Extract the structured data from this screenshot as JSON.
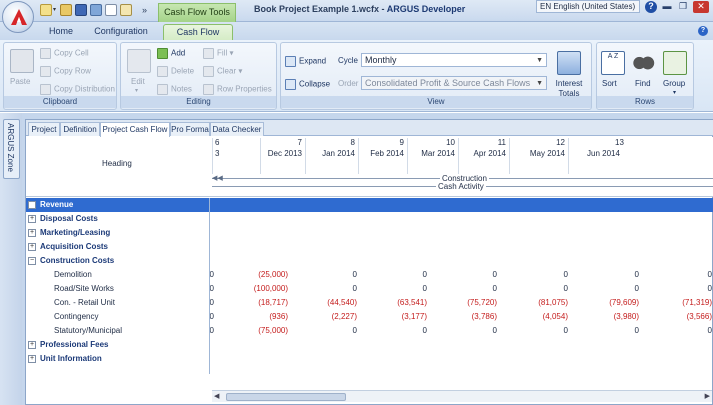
{
  "titlebar": {
    "context_tab": "Cash Flow Tools",
    "doc_title_prefix": "Book Project Example 1.wcfx - ",
    "doc_title_app": "ARGUS Developer",
    "language": "EN English (United States)",
    "qat_overflow": "»"
  },
  "ribbon_tabs": [
    "Home",
    "Configuration",
    "Cash Flow"
  ],
  "ribbon": {
    "clipboard": {
      "label": "Clipboard",
      "paste": "Paste",
      "copy_cell": "Copy Cell",
      "copy_row": "Copy Row",
      "copy_distribution": "Copy Distribution"
    },
    "editing": {
      "label": "Editing",
      "edit": "Edit",
      "add": "Add",
      "delete": "Delete",
      "notes": "Notes",
      "fill": "Fill",
      "clear": "Clear",
      "row_properties": "Row Properties"
    },
    "view": {
      "label": "View",
      "expand": "Expand",
      "collapse": "Collapse",
      "cycle_label": "Cycle",
      "cycle_value": "Monthly",
      "order_label": "Order",
      "order_value": "Consolidated Profit & Source Cash Flows",
      "interest_totals": "Interest Totals"
    },
    "rows": {
      "label": "Rows",
      "sort": "Sort",
      "find": "Find",
      "group": "Group"
    }
  },
  "zone_tab": "ARGUS Zone",
  "sheet_tabs": [
    "Project",
    "Definition",
    "Project Cash Flow",
    "Pro Forma",
    "Data Checker"
  ],
  "active_sheet_tab": "Project Cash Flow",
  "grid": {
    "heading": "Heading",
    "columns": [
      {
        "num": "6",
        "date": "3"
      },
      {
        "num": "7",
        "date": "Dec 2013"
      },
      {
        "num": "8",
        "date": "Jan 2014"
      },
      {
        "num": "9",
        "date": "Feb 2014"
      },
      {
        "num": "10",
        "date": "Mar 2014"
      },
      {
        "num": "11",
        "date": "Apr 2014"
      },
      {
        "num": "12",
        "date": "May 2014"
      },
      {
        "num": "13",
        "date": "Jun 2014"
      }
    ],
    "timeline": {
      "phase": "Construction",
      "activity": "Cash Activity"
    },
    "rows": [
      {
        "label": "Revenue",
        "type": "group",
        "toggle": "+",
        "selected": true,
        "values": []
      },
      {
        "label": "Disposal Costs",
        "type": "group",
        "toggle": "+",
        "values": []
      },
      {
        "label": "Marketing/Leasing",
        "type": "group",
        "toggle": "+",
        "values": []
      },
      {
        "label": "Acquisition Costs",
        "type": "group",
        "toggle": "+",
        "values": []
      },
      {
        "label": "Construction Costs",
        "type": "group",
        "toggle": "−",
        "values": []
      },
      {
        "label": "Demolition",
        "type": "item",
        "values": [
          "0",
          "(25,000)",
          "0",
          "0",
          "0",
          "0",
          "0",
          "0"
        ]
      },
      {
        "label": "Road/Site Works",
        "type": "item",
        "values": [
          "0",
          "(100,000)",
          "0",
          "0",
          "0",
          "0",
          "0",
          "0"
        ]
      },
      {
        "label": "Con. - Retail Unit",
        "type": "item",
        "values": [
          "0",
          "(18,717)",
          "(44,540)",
          "(63,541)",
          "(75,720)",
          "(81,075)",
          "(79,609)",
          "(71,319)"
        ]
      },
      {
        "label": "Contingency",
        "type": "item",
        "values": [
          "0",
          "(936)",
          "(2,227)",
          "(3,177)",
          "(3,786)",
          "(4,054)",
          "(3,980)",
          "(3,566)"
        ]
      },
      {
        "label": "Statutory/Municipal",
        "type": "item",
        "values": [
          "0",
          "(75,000)",
          "0",
          "0",
          "0",
          "0",
          "0",
          "0"
        ]
      },
      {
        "label": "Professional Fees",
        "type": "group",
        "toggle": "+",
        "values": []
      },
      {
        "label": "Unit Information",
        "type": "group",
        "toggle": "+",
        "values": []
      }
    ]
  },
  "colors": {
    "accent_green": "#8bbf6b",
    "selection_blue": "#2f6bd0",
    "negative_red": "#c41c1c",
    "group_text": "#1c3a78"
  }
}
